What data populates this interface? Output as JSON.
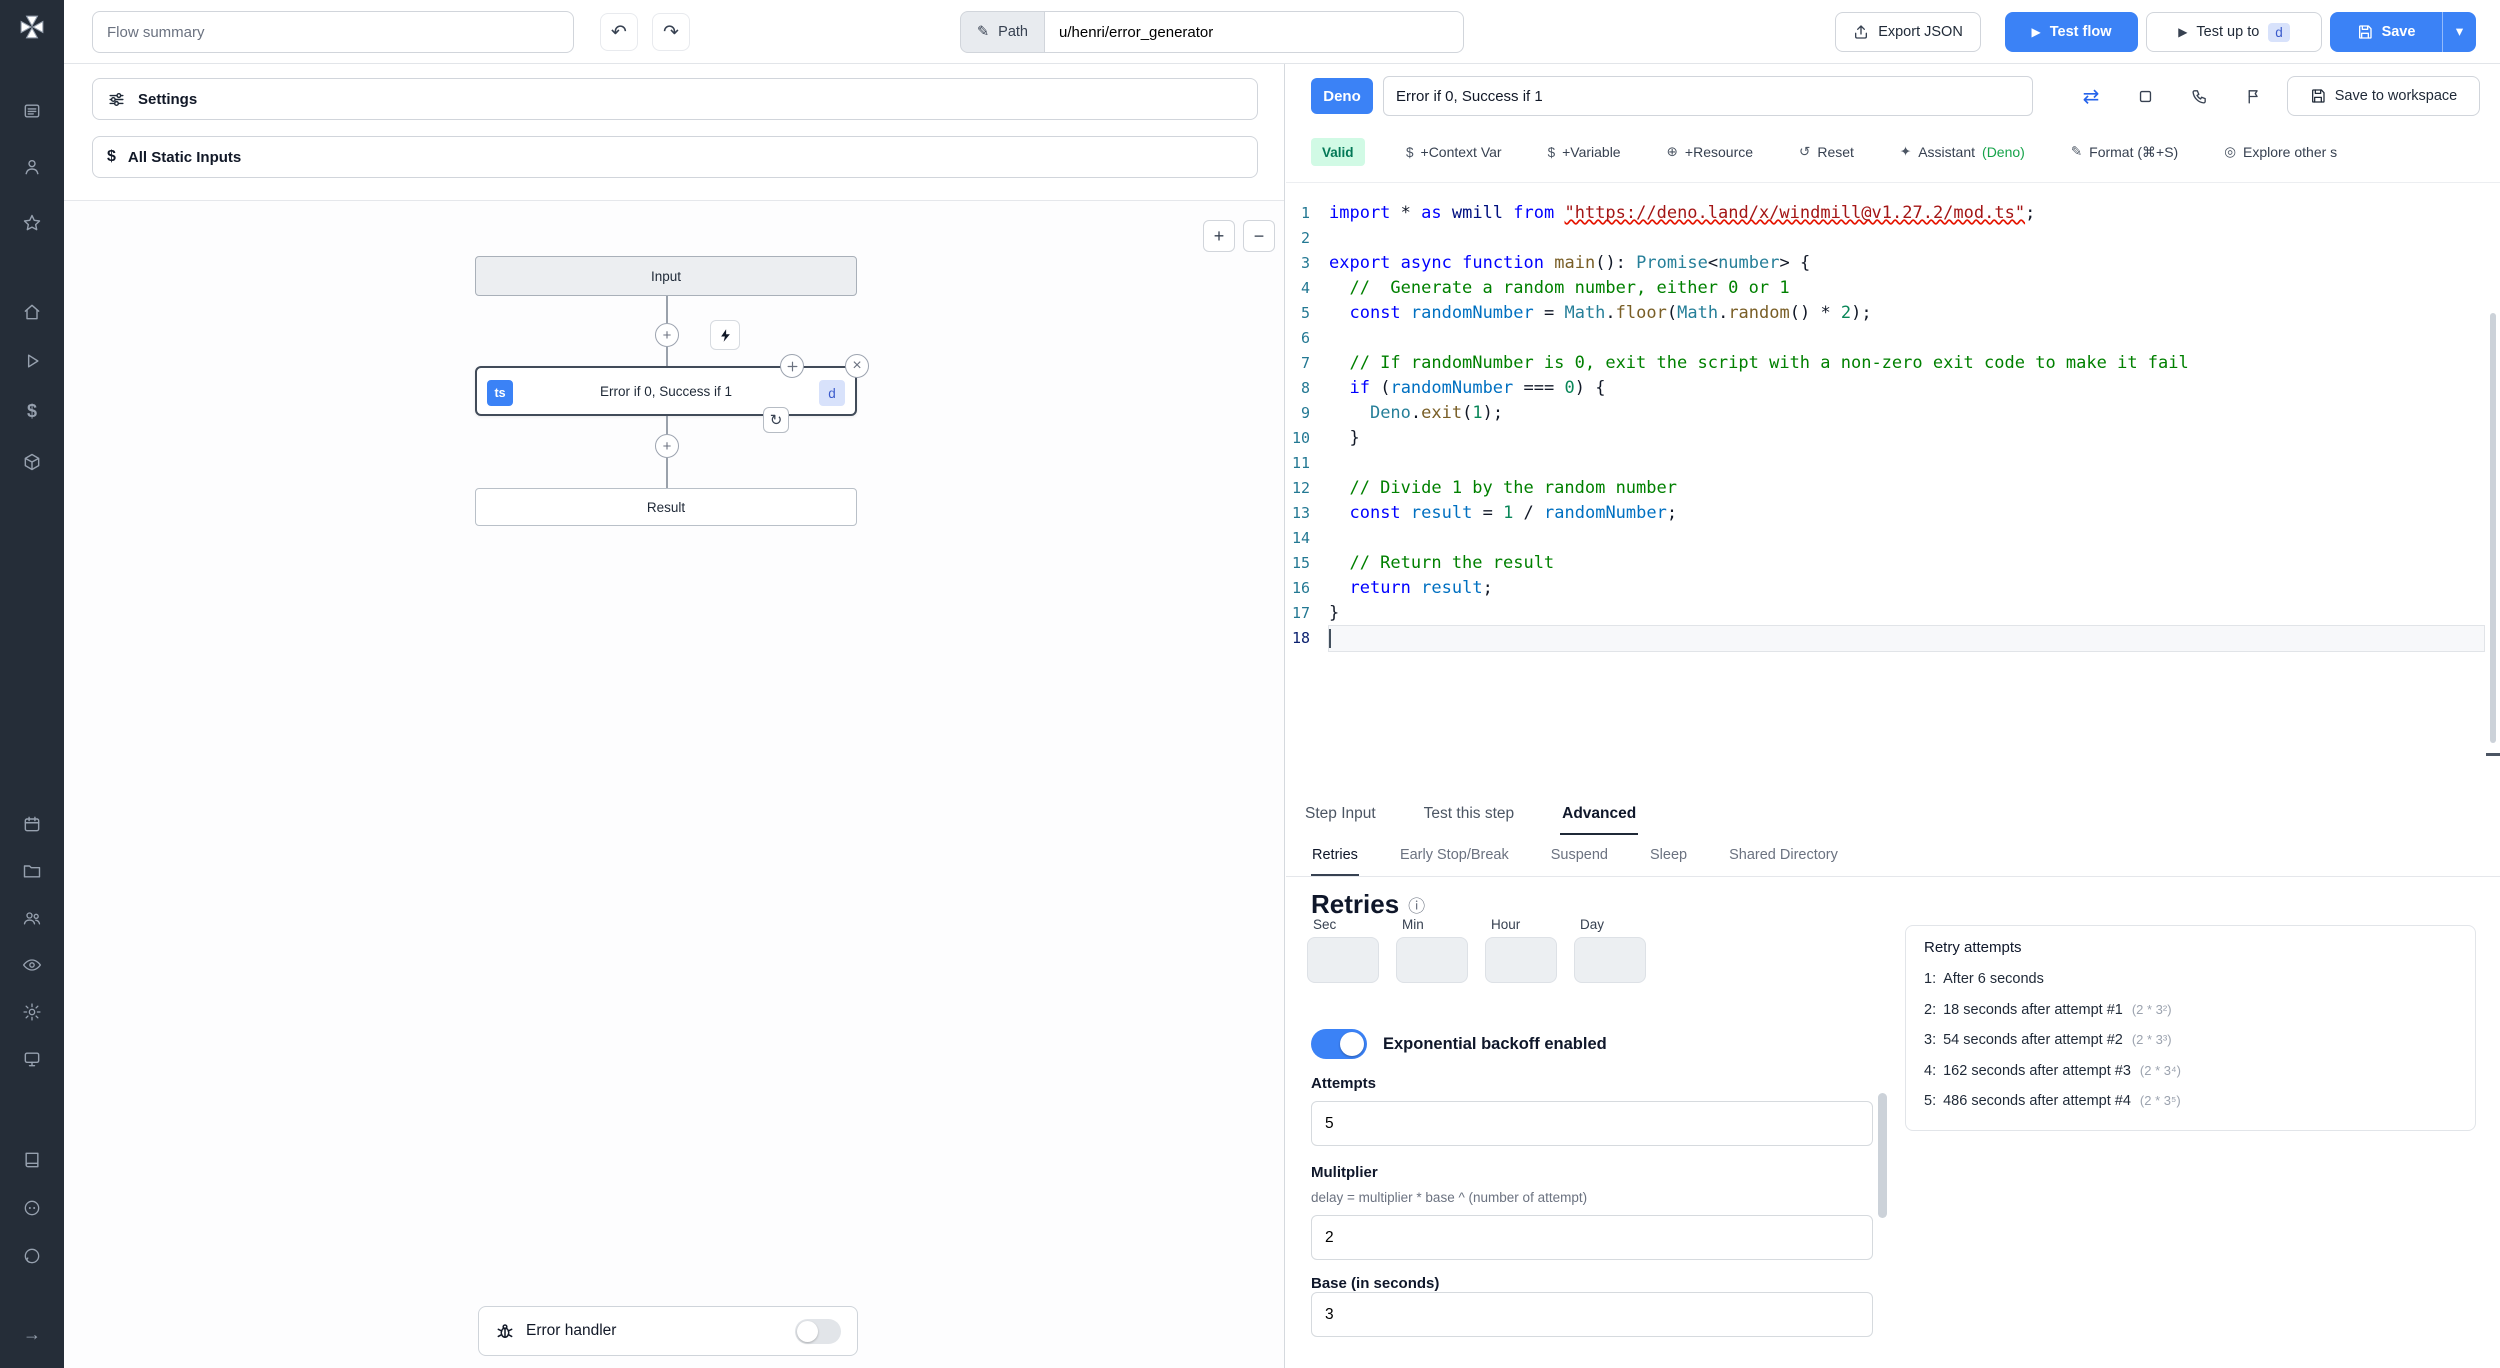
{
  "colors": {
    "accent_blue": "#3b82f6",
    "sidebar_bg": "#252d38",
    "valid_bg": "#d1fae5",
    "valid_text": "#047857",
    "assistant_green": "#16a34a"
  },
  "icons": {
    "pencil": "✎",
    "undo": "↶",
    "redo": "↷",
    "play": "▶",
    "chevron_down": "▾",
    "plus": "+",
    "minus": "−",
    "close": "×",
    "swap": "⇄",
    "loop": "↻",
    "reset": "↺",
    "info": "ⓘ",
    "dollar": "$",
    "arrow_right": "→"
  },
  "sidebar": {
    "icon_names": [
      "windmill-logo",
      "runs",
      "user",
      "favorites",
      "home",
      "scripts",
      "variables",
      "resources",
      "schedules",
      "folders",
      "groups",
      "audit-logs",
      "settings",
      "workers",
      "docs",
      "discord",
      "github",
      "expand"
    ]
  },
  "topbar": {
    "flow_summary_placeholder": "Flow summary",
    "path_label": "Path",
    "path_value": "u/henri/error_generator",
    "export_json_label": "Export JSON",
    "test_flow_label": "Test flow",
    "test_up_to_label": "Test up to",
    "test_up_to_badge": "d",
    "save_label": "Save"
  },
  "flow": {
    "settings_label": "Settings",
    "static_inputs_label": "All Static Inputs",
    "input_node_label": "Input",
    "step_node_label": "Error if 0, Success if 1",
    "step_lang_badge": "ts",
    "step_id_badge": "d",
    "result_node_label": "Result",
    "error_handler_label": "Error handler"
  },
  "editor": {
    "lang_badge": "Deno",
    "step_name_value": "Error if 0, Success if 1",
    "save_to_workspace_label": "Save to workspace",
    "valid_badge": "Valid",
    "toolbar_items": [
      {
        "icon": "$",
        "label": "+Context Var"
      },
      {
        "icon": "$",
        "label": "+Variable"
      },
      {
        "icon": "⊕",
        "label": "+Resource"
      },
      {
        "icon": "↺",
        "label": "Reset"
      },
      {
        "icon": "✦",
        "label": "Assistant",
        "suffix": "(Deno)"
      },
      {
        "icon": "✎",
        "label": "Format (⌘+S)"
      },
      {
        "icon": "◎",
        "label": "Explore other s"
      }
    ],
    "active_line": 18,
    "code_lines": [
      [
        [
          "import",
          "kw"
        ],
        [
          " * "
        ],
        [
          "as",
          "kw"
        ],
        [
          " wmill ",
          "var"
        ],
        [
          "from",
          "kw"
        ],
        [
          " "
        ],
        [
          "\"https://deno.land/x/windmill@v1.27.2/mod.ts\"",
          "str err"
        ],
        [
          ";"
        ]
      ],
      [],
      [
        [
          "export",
          "kw"
        ],
        [
          " "
        ],
        [
          "async",
          "kw"
        ],
        [
          " "
        ],
        [
          "function",
          "kw"
        ],
        [
          " "
        ],
        [
          "main",
          "fn"
        ],
        [
          "(): "
        ],
        [
          "Promise",
          "type"
        ],
        [
          "<"
        ],
        [
          "number",
          "type"
        ],
        [
          "> {"
        ]
      ],
      [
        [
          "  //  Generate a random number, either 0 or 1",
          "cmt"
        ]
      ],
      [
        [
          "  "
        ],
        [
          "const",
          "kw"
        ],
        [
          " "
        ],
        [
          "randomNumber",
          "cvar"
        ],
        [
          " = "
        ],
        [
          "Math",
          "type"
        ],
        [
          "."
        ],
        [
          "floor",
          "fn"
        ],
        [
          "("
        ],
        [
          "Math",
          "type"
        ],
        [
          "."
        ],
        [
          "random",
          "fn"
        ],
        [
          "() * "
        ],
        [
          "2",
          "num"
        ],
        [
          ");"
        ]
      ],
      [],
      [
        [
          "  // If randomNumber is 0, exit the script with a non-zero exit code to make it fail",
          "cmt"
        ]
      ],
      [
        [
          "  "
        ],
        [
          "if",
          "kw"
        ],
        [
          " ("
        ],
        [
          "randomNumber",
          "cvar"
        ],
        [
          " === "
        ],
        [
          "0",
          "num"
        ],
        [
          ") {"
        ]
      ],
      [
        [
          "    "
        ],
        [
          "Deno",
          "type"
        ],
        [
          "."
        ],
        [
          "exit",
          "fn"
        ],
        [
          "("
        ],
        [
          "1",
          "num"
        ],
        [
          ");"
        ]
      ],
      [
        [
          "  }"
        ]
      ],
      [],
      [
        [
          "  // Divide 1 by the random number",
          "cmt"
        ]
      ],
      [
        [
          "  "
        ],
        [
          "const",
          "kw"
        ],
        [
          " "
        ],
        [
          "result",
          "cvar"
        ],
        [
          " = "
        ],
        [
          "1",
          "num"
        ],
        [
          " / "
        ],
        [
          "randomNumber",
          "cvar"
        ],
        [
          ";"
        ]
      ],
      [],
      [
        [
          "  // Return the result",
          "cmt"
        ]
      ],
      [
        [
          "  "
        ],
        [
          "return",
          "kw"
        ],
        [
          " "
        ],
        [
          "result",
          "cvar"
        ],
        [
          ";"
        ]
      ],
      [
        [
          "}"
        ]
      ],
      []
    ]
  },
  "panel": {
    "tabs": [
      "Step Input",
      "Test this step",
      "Advanced"
    ],
    "active_tab": "Advanced",
    "subtabs": [
      "Retries",
      "Early Stop/Break",
      "Suspend",
      "Sleep",
      "Shared Directory"
    ],
    "active_subtab": "Retries",
    "retries": {
      "heading": "Retries",
      "cron_fields": [
        "Sec",
        "Min",
        "Hour",
        "Day"
      ],
      "toggle_label": "Exponential backoff enabled",
      "toggle_on": true,
      "attempts_label": "Attempts",
      "attempts_value": "5",
      "multiplier_label": "Mulitplier",
      "multiplier_desc": "delay = multiplier * base ^ (number of attempt)",
      "multiplier_value": "2",
      "base_label": "Base (in seconds)",
      "base_value": "3",
      "retry_box_title": "Retry attempts",
      "retry_rows": [
        {
          "n": "1:",
          "text": "After 6 seconds",
          "formula": ""
        },
        {
          "n": "2:",
          "text": "18 seconds after attempt #1",
          "formula": "(2 * 3²)"
        },
        {
          "n": "3:",
          "text": "54 seconds after attempt #2",
          "formula": "(2 * 3³)"
        },
        {
          "n": "4:",
          "text": "162 seconds after attempt #3",
          "formula": "(2 * 3⁴)"
        },
        {
          "n": "5:",
          "text": "486 seconds after attempt #4",
          "formula": "(2 * 3⁵)"
        }
      ]
    }
  }
}
